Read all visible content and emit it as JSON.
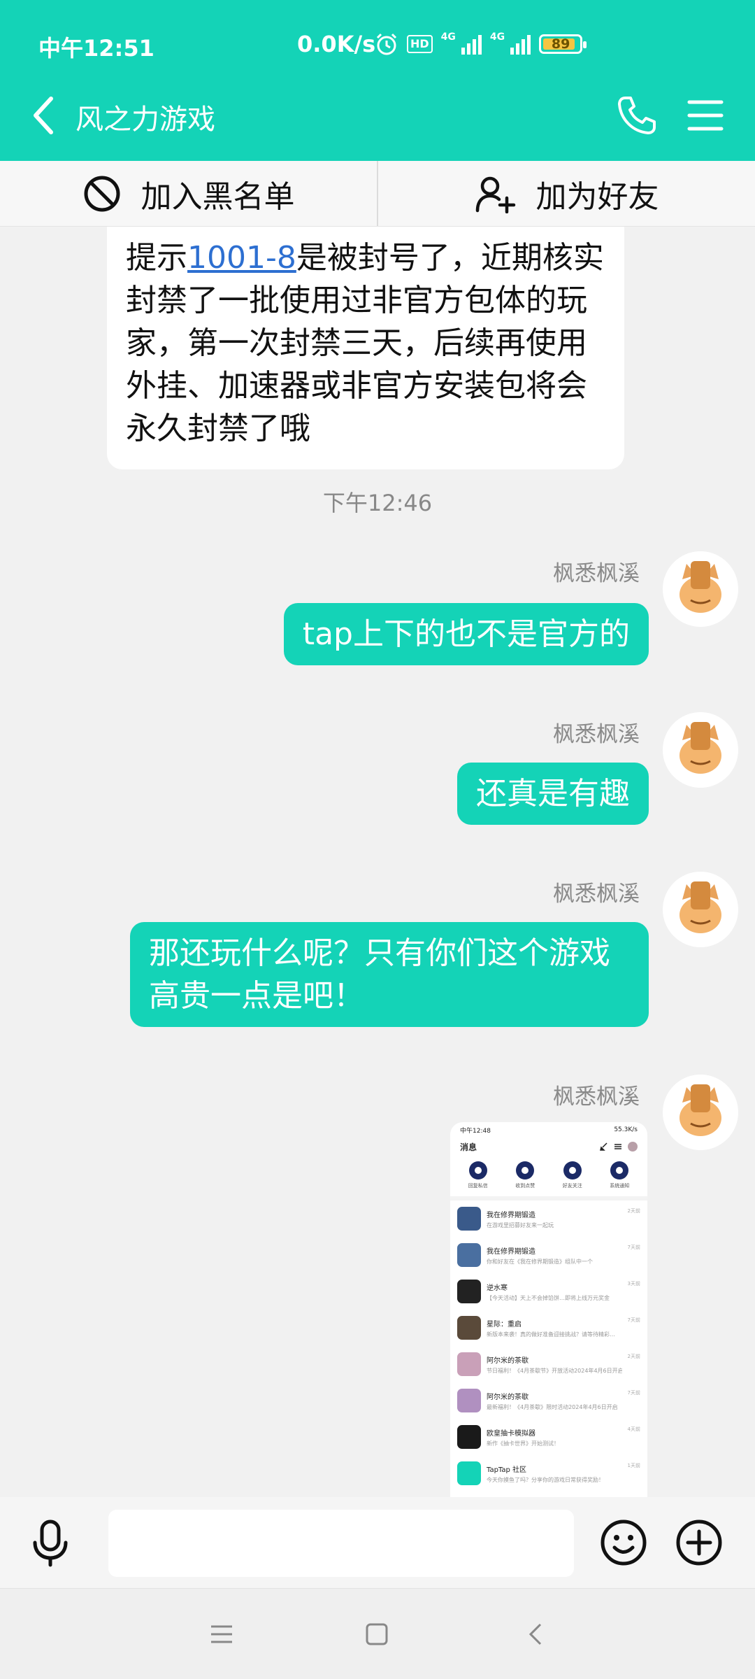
{
  "status": {
    "time": "中午12:51",
    "speed": "0.0K/s",
    "hd": "HD",
    "net1": "4G",
    "net2": "4G",
    "battery": "89"
  },
  "header": {
    "title": "风之力游戏"
  },
  "actions": {
    "blacklist": "加入黑名单",
    "add_friend": "加为好友"
  },
  "messages": {
    "incoming": {
      "prefix": "提示",
      "link": "1001-8",
      "rest": "是被封号了，近期核实封禁了一批使用过非官方包体的玩家，第一次封禁三天，后续再使用外挂、加速器或非官方安装包将会永久封禁了哦"
    },
    "timestamp": "下午12:46",
    "outgoing": [
      {
        "sender": "枫悉枫溪",
        "text": "tap上下的也不是官方的"
      },
      {
        "sender": "枫悉枫溪",
        "text": "还真是有趣"
      },
      {
        "sender": "枫悉枫溪",
        "text": "那还玩什么呢？只有你们这个游戏高贵一点是吧！"
      },
      {
        "sender": "枫悉枫溪"
      }
    ]
  },
  "screenshot": {
    "time": "中午12:48",
    "speed": "55.3K/s",
    "title": "消息",
    "quick": [
      "回复私信",
      "收到点赞",
      "好友关注",
      "系统通知"
    ],
    "items": [
      {
        "title": "我在修界期锻造",
        "sub": "在游戏里招募好友来一起玩",
        "date": "2天前",
        "color": "#3a5a8a"
      },
      {
        "title": "我在修界期锻造",
        "sub": "你和好友在《我在修界期锻造》组队中一个",
        "date": "7天前",
        "color": "#4a6fa0"
      },
      {
        "title": "逆水寒",
        "sub": "【今天活动】天上不会掉馅饼…即将上线万元奖金",
        "date": "3天前",
        "color": "#222222"
      },
      {
        "title": "星际：重启",
        "sub": "新版本来袭！真的做好准备迎接挑战？请等待精彩…",
        "date": "7天前",
        "color": "#5a4a3a"
      },
      {
        "title": "阿尔米的茶歇",
        "sub": "节日福利！《4月茶歇节》开放活动2024年4月6日开启",
        "date": "2天前",
        "color": "#c9a0b8"
      },
      {
        "title": "阿尔米的茶歇",
        "sub": "最新福利！《4月茶歇》限时活动2024年4月6日开启",
        "date": "7天前",
        "color": "#b090c0"
      },
      {
        "title": "欧皇抽卡模拟器",
        "sub": "新作《抽卡世界》开始测试！",
        "date": "4天前",
        "color": "#1a1a1a"
      },
      {
        "title": "TapTap 社区",
        "sub": "今天你摸鱼了吗？分享你的游戏日常获得奖励！",
        "date": "1天前",
        "color": "#14d3b7"
      }
    ]
  },
  "input": {
    "placeholder": ""
  }
}
